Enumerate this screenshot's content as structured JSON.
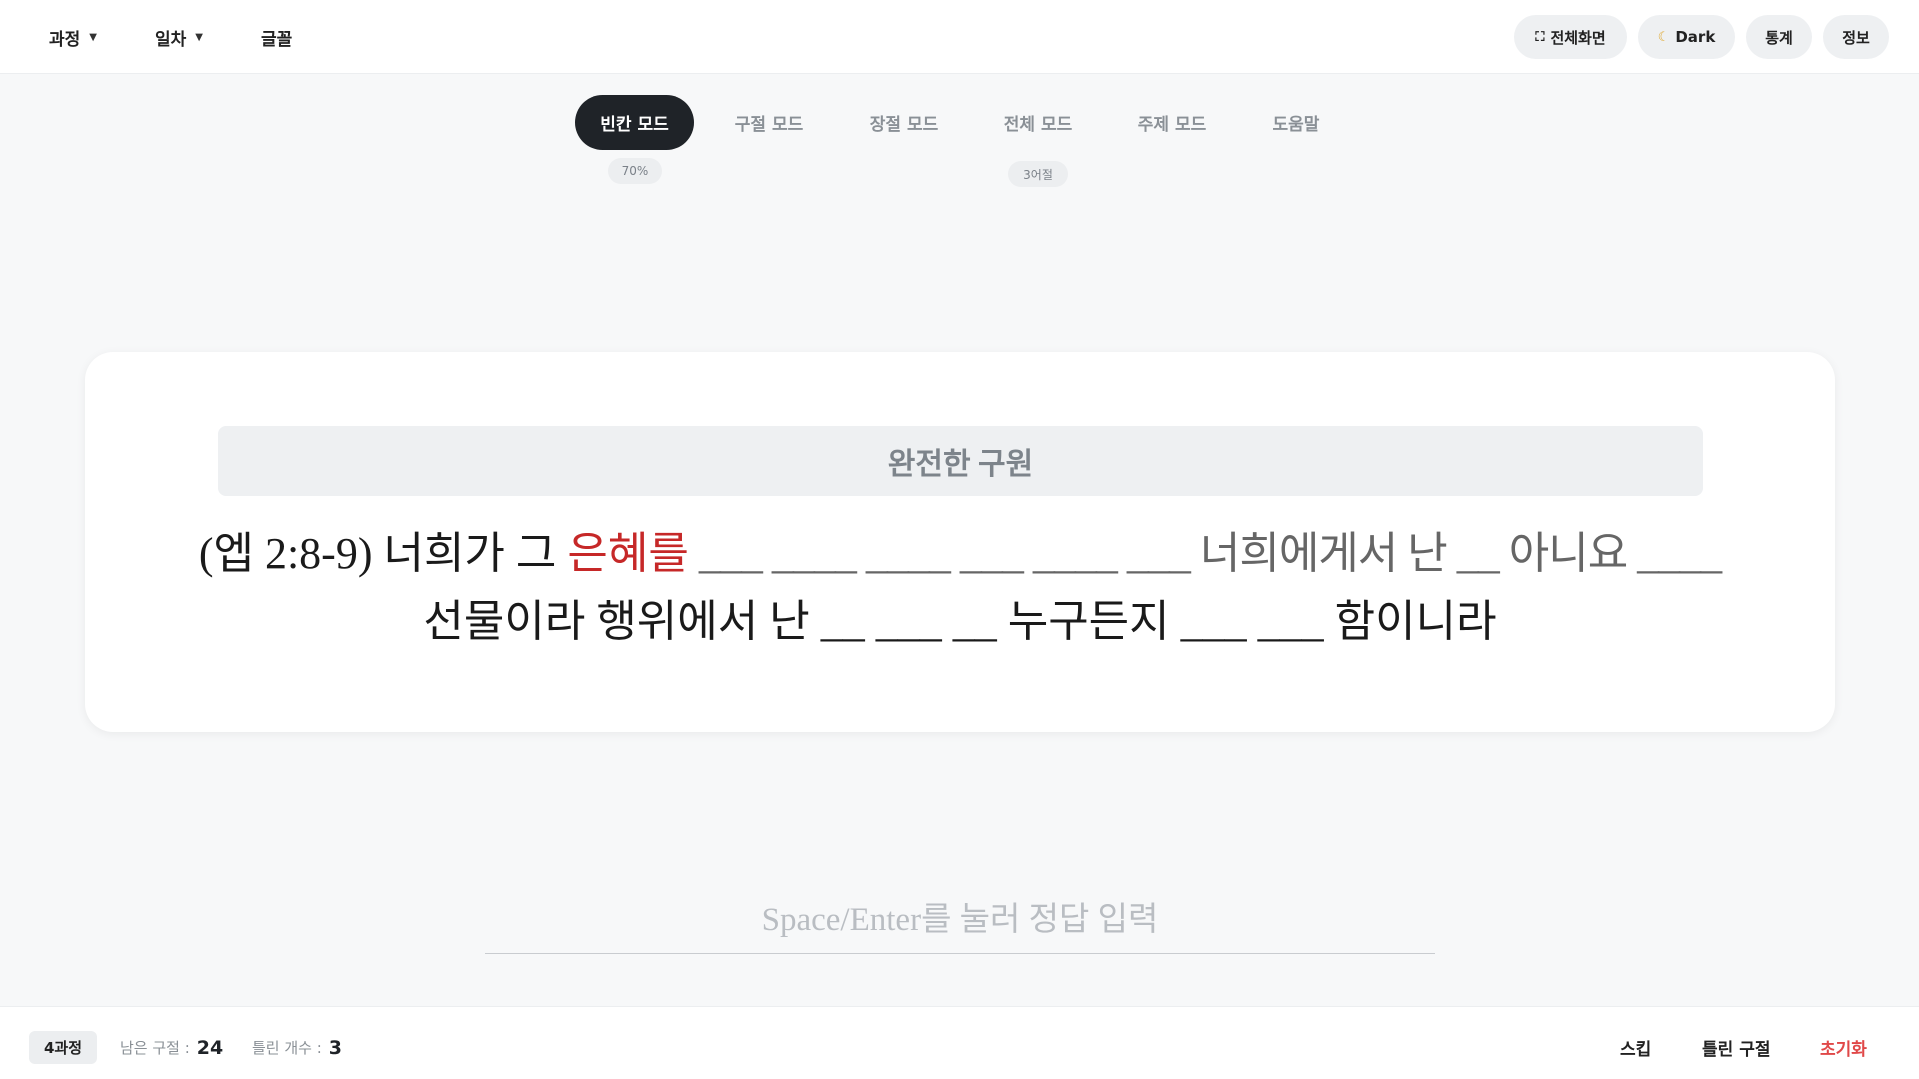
{
  "topbar": {
    "course_label": "과정",
    "day_label": "일차",
    "font_label": "글꼴",
    "fullscreen_label": "전체화면",
    "dark_label": "Dark",
    "stats_label": "통계",
    "info_label": "정보"
  },
  "modes": {
    "tabs": [
      "빈칸 모드",
      "구절 모드",
      "장절 모드",
      "전체 모드",
      "주제 모드",
      "도움말"
    ],
    "active": "빈칸 모드",
    "blank_badge": "70%",
    "all_badge": "3어절"
  },
  "card": {
    "topic": "완전한 구원",
    "verse_line1_pre": "(엡 2:8-9) 너희가 그 ",
    "verse_highlight": "은혜를",
    "verse_line1_post": " ___ ____ ____ ___ ____ ___ 너희에게서 난 __ 아니요 ____",
    "verse_line2": "선물이라 행위에서 난 __ ___ __ 누구든지 ___ ___ 함이니라"
  },
  "answer": {
    "placeholder": "Space/Enter를 눌러 정답 입력",
    "value": ""
  },
  "footer": {
    "course_tag": "4과정",
    "remaining_label": "남은 구절 :",
    "remaining_value": "24",
    "wrong_label": "틀린 개수 :",
    "wrong_value": "3",
    "skip_label": "스킵",
    "wrong_verses_label": "틀린 구절",
    "reset_label": "초기화"
  },
  "colors": {
    "accent_dark": "#1f2328",
    "highlight_red": "#c62828",
    "reset_red": "#e04848",
    "background": "#f7f8f9"
  },
  "icons": {
    "fullscreen": "fullscreen-icon",
    "dark": "moon-icon",
    "dropdown": "caret-down-icon"
  }
}
